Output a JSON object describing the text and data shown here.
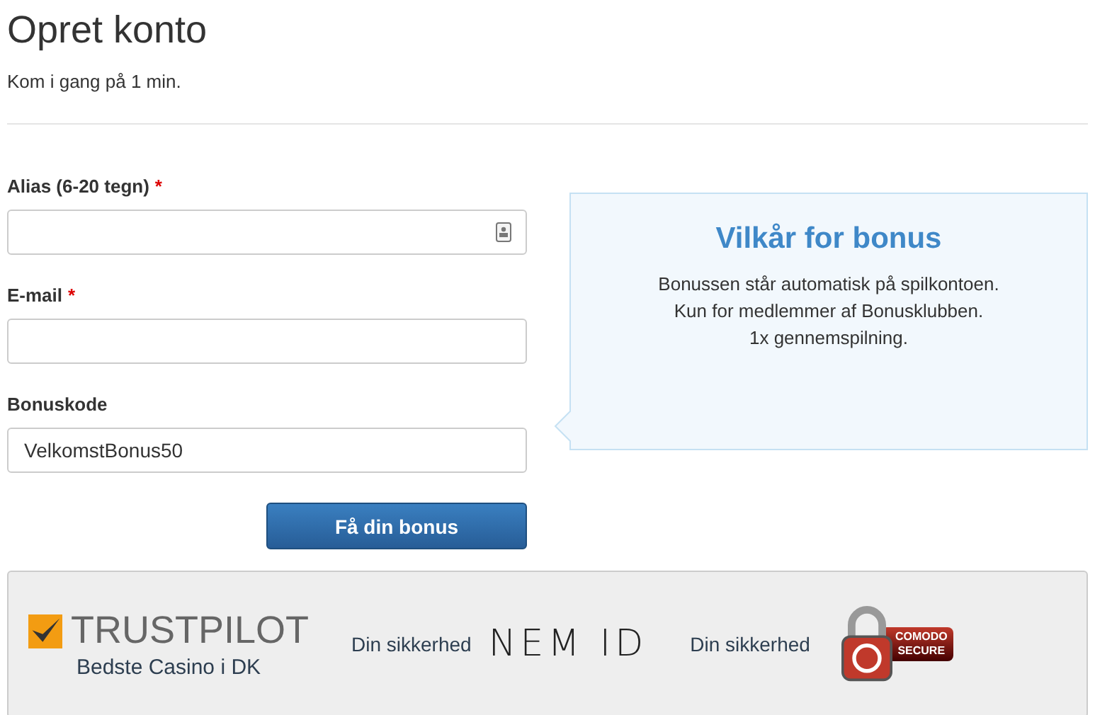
{
  "header": {
    "title": "Opret konto",
    "subtitle": "Kom i gang på 1 min."
  },
  "fields": [
    {
      "label": "Alias (6-20 tegn)",
      "required_mark": "*",
      "has_contact_icon": true
    },
    {
      "label": "E-mail",
      "required_mark": "*",
      "has_contact_icon": false
    },
    {
      "label": "Bonuskode",
      "value": "VelkomstBonus50",
      "has_contact_icon": false
    }
  ],
  "submit_button": "Få din bonus",
  "bonus_info": {
    "title": "Vilkår for bonus",
    "lines": [
      "Bonussen står automatisk på spilkontoen.",
      "Kun for medlemmer af Bonusklubben.",
      "1x gennemspilning."
    ]
  },
  "trust_bar": {
    "trustpilot": {
      "logo": "TRUSTPILOT",
      "caption": "Bedste Casino i DK"
    },
    "nemid": {
      "label": "Din sikkerhed",
      "logo": "NEM ID"
    },
    "comodo": {
      "label": "Din sikkerhed",
      "badge_top": "COMODO",
      "badge_bottom": "SECURE"
    }
  }
}
